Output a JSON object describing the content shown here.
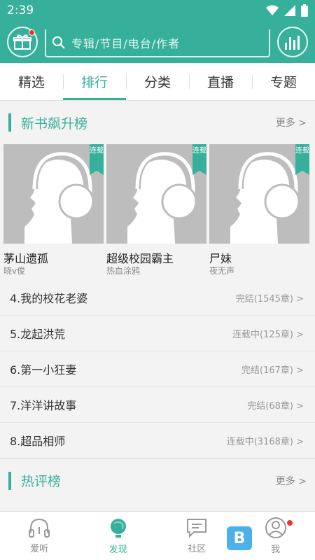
{
  "status_bar": {
    "time": "2:39"
  },
  "search": {
    "placeholder": "专辑/节目/电台/作者"
  },
  "tabs": [
    {
      "label": "精选"
    },
    {
      "label": "排行",
      "active": true
    },
    {
      "label": "分类"
    },
    {
      "label": "直播"
    },
    {
      "label": "专题"
    }
  ],
  "section_new": {
    "title": "新书飙升榜",
    "more": "更多 >",
    "books": [
      {
        "title": "茅山遗孤",
        "author": "晓v俊",
        "badge": "连载"
      },
      {
        "title": "超级校园霸主",
        "author": "热血涂鸦",
        "badge": "连载"
      },
      {
        "title": "尸妹",
        "author": "夜无声",
        "badge": "连载"
      }
    ],
    "list": [
      {
        "name": "4.我的校花老婆",
        "status": "完结(1545章) >"
      },
      {
        "name": "5.龙起洪荒",
        "status": "连载中(125章) >"
      },
      {
        "name": "6.第一小狂妻",
        "status": "完结(167章) >"
      },
      {
        "name": "7.洋洋讲故事",
        "status": "完结(68章) >"
      },
      {
        "name": "8.超品相师",
        "status": "连载中(3168章) >"
      }
    ]
  },
  "section_hot": {
    "title": "热评榜",
    "more": "更多 >"
  },
  "bottom_nav": [
    {
      "label": "爱听",
      "icon": "headphones-icon"
    },
    {
      "label": "发现",
      "icon": "globe-icon",
      "active": true
    },
    {
      "label": "社区",
      "icon": "chat-icon"
    },
    {
      "label": "我",
      "icon": "user-icon"
    }
  ],
  "colors": {
    "accent": "#37b09b",
    "badge_dot": "#e8382e"
  }
}
